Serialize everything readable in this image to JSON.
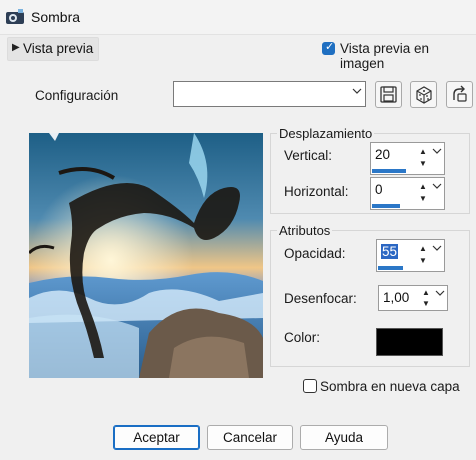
{
  "window": {
    "title": "Sombra"
  },
  "preview_toggle": {
    "label": "Vista previa"
  },
  "preview_check": {
    "label": "Vista previa en imagen",
    "checked": true
  },
  "config": {
    "label": "Configuración",
    "value": ""
  },
  "desplazamiento": {
    "title": "Desplazamiento",
    "vertical": {
      "label": "Vertical:",
      "value": "20",
      "level": 0.67
    },
    "horizontal": {
      "label": "Horizontal:",
      "value": "0",
      "level": 0.55
    }
  },
  "atributos": {
    "title": "Atributos",
    "opacidad": {
      "label": "Opacidad:",
      "value": "55",
      "level": 0.55
    },
    "desenfocar": {
      "label": "Desenfocar:",
      "value": "1,00"
    },
    "color": {
      "label": "Color:",
      "value": "#000000"
    }
  },
  "new_layer": {
    "label": "Sombra en nueva capa",
    "checked": false
  },
  "buttons": {
    "accept": "Aceptar",
    "cancel": "Cancelar",
    "help": "Ayuda"
  }
}
